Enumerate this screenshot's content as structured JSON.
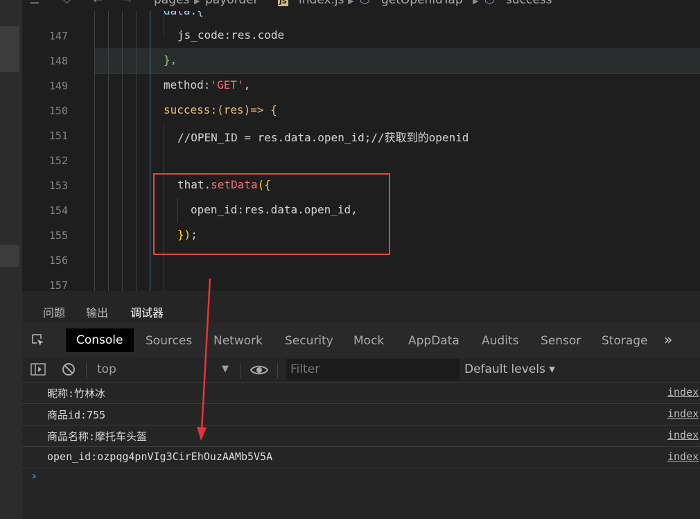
{
  "breadcrumb": {
    "items": [
      "pages",
      "payorder",
      "index.js",
      "getOpenidTap",
      "success"
    ],
    "js_badge": "JS"
  },
  "code_lines": [
    {
      "num": "147"
    },
    {
      "num": "148"
    },
    {
      "num": "149"
    },
    {
      "num": "150"
    },
    {
      "num": "151"
    },
    {
      "num": "152"
    },
    {
      "num": "153"
    },
    {
      "num": "154"
    },
    {
      "num": "155"
    },
    {
      "num": "156"
    },
    {
      "num": "157"
    }
  ],
  "code": {
    "l147_key": "js_code",
    "l147_val": ":res.code",
    "l148": "},",
    "l149_key": "method",
    "l149_val": "'GET'",
    "l150_key": "success",
    "l150_rest": ":(res)=> {",
    "l151": "//OPEN_ID = res.data.open_id;//获取到的openid",
    "l153_obj": "that.",
    "l153_fn": "setData",
    "l153_br": "({",
    "l154": "open_id:res.data.open_id,",
    "l155_br": "})",
    "l155_end": ";"
  },
  "panel_tabs": [
    "问题",
    "输出",
    "调试器"
  ],
  "devtools_tabs": [
    "Console",
    "Sources",
    "Network",
    "Security",
    "Mock",
    "AppData",
    "Audits",
    "Sensor",
    "Storage"
  ],
  "more_glyph": "»",
  "console_toolbar": {
    "context": "top",
    "filter_placeholder": "Filter",
    "levels": "Default levels ▾"
  },
  "console_logs": [
    {
      "message": "昵称:竹林冰",
      "source": "index"
    },
    {
      "message": "商品id:755",
      "source": "index"
    },
    {
      "message": "商品名称:摩托车头盔",
      "source": "index"
    },
    {
      "message": "open_id:ozpqg4pnVIg3CirEhOuzAAMb5V5A",
      "source": "index"
    }
  ],
  "prompt_glyph": "›",
  "colors": {
    "highlight_box": "#e04646",
    "annotation_arrow": "#e8333a"
  }
}
